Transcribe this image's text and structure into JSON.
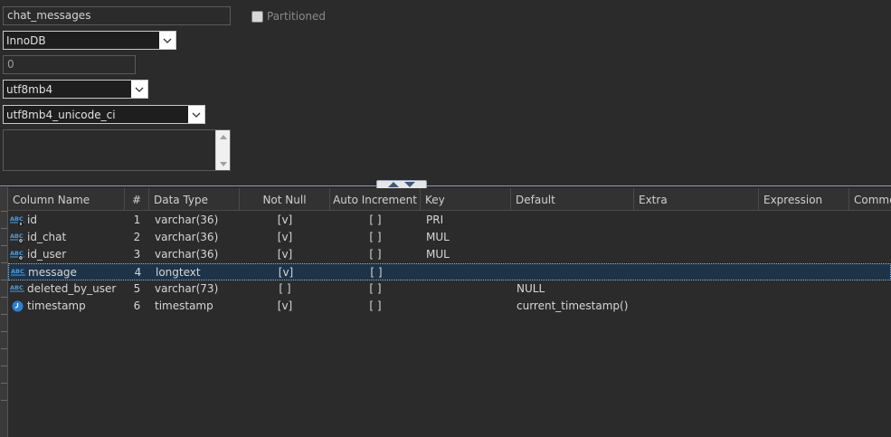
{
  "form": {
    "table_name": "chat_messages",
    "partitioned_label": "Partitioned",
    "engine": "InnoDB",
    "auto_increment": "0",
    "charset": "utf8mb4",
    "collation": "utf8mb4_unicode_ci",
    "comment": ""
  },
  "grid": {
    "headers": [
      "Column Name",
      "#",
      "Data Type",
      "Not Null",
      "Auto Increment",
      "Key",
      "Default",
      "Extra",
      "Expression",
      "Comme"
    ],
    "rows": [
      {
        "name": "id",
        "num": "1",
        "type": "varchar(36)",
        "not_null": "[v]",
        "auto_inc": "[  ]",
        "key": "PRI",
        "default": "",
        "icon": "abc-key-icon"
      },
      {
        "name": "id_chat",
        "num": "2",
        "type": "varchar(36)",
        "not_null": "[v]",
        "auto_inc": "[  ]",
        "key": "MUL",
        "default": "",
        "icon": "abc-index-icon"
      },
      {
        "name": "id_user",
        "num": "3",
        "type": "varchar(36)",
        "not_null": "[v]",
        "auto_inc": "[  ]",
        "key": "MUL",
        "default": "",
        "icon": "abc-index-icon"
      },
      {
        "name": "message",
        "num": "4",
        "type": "longtext",
        "not_null": "[v]",
        "auto_inc": "[  ]",
        "key": "",
        "default": "",
        "icon": "abc-icon"
      },
      {
        "name": "deleted_by_user",
        "num": "5",
        "type": "varchar(73)",
        "not_null": "[  ]",
        "auto_inc": "[  ]",
        "key": "",
        "default": "NULL",
        "icon": "abc-icon"
      },
      {
        "name": "timestamp",
        "num": "6",
        "type": "timestamp",
        "not_null": "[v]",
        "auto_inc": "[  ]",
        "key": "",
        "default": "current_timestamp()",
        "icon": "clock-icon"
      }
    ]
  },
  "colors": {
    "background": "#2b2b2b",
    "selected_row": "#1f3348",
    "icon_blue": "#4a9ee0"
  }
}
